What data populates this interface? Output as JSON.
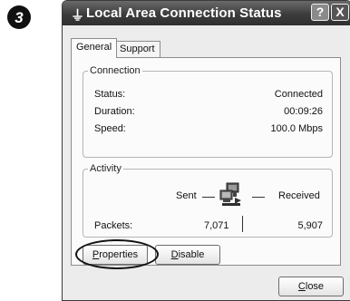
{
  "step": {
    "number": "3"
  },
  "window": {
    "title": "Local Area Connection Status",
    "help_glyph": "?",
    "close_glyph": "X"
  },
  "tabs": [
    {
      "label": "General"
    },
    {
      "label": "Support"
    }
  ],
  "connection": {
    "legend": "Connection",
    "rows": [
      {
        "label": "Status:",
        "value": "Connected"
      },
      {
        "label": "Duration:",
        "value": "00:09:26"
      },
      {
        "label": "Speed:",
        "value": "100.0 Mbps"
      }
    ]
  },
  "activity": {
    "legend": "Activity",
    "sent_label": "Sent",
    "received_label": "Received",
    "packets_label": "Packets:",
    "packets_sent": "7,071",
    "packets_received": "5,907",
    "icon": "network-computers-icon"
  },
  "buttons": {
    "properties": {
      "first": "P",
      "rest": "roperties"
    },
    "disable": {
      "first": "D",
      "rest": "isable"
    },
    "close": {
      "first": "C",
      "rest": "lose"
    }
  }
}
